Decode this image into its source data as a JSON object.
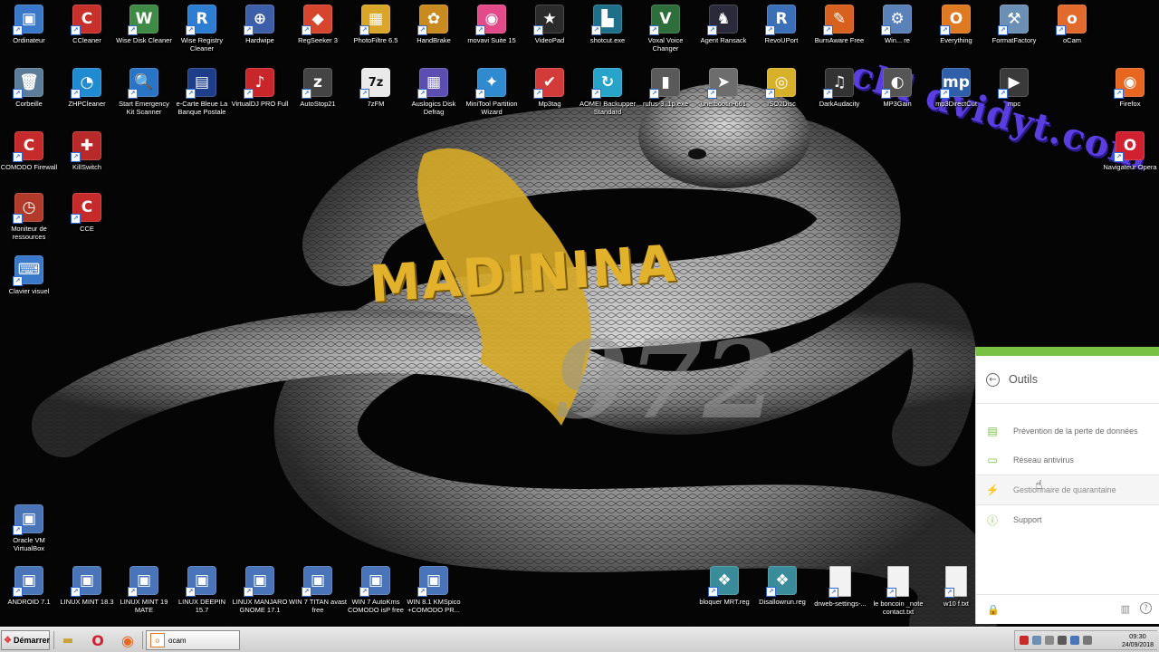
{
  "watermark": "cbl dvidyt.com",
  "wallpaper": {
    "logo_text": "MADININA",
    "number_text": "972"
  },
  "desktop_icons": [
    {
      "id": "ordinateur",
      "label": "Ordinateur",
      "icon": "computer-icon",
      "color": "#3a78c9",
      "glyph": "▣"
    },
    {
      "id": "ccleaner",
      "label": "CCleaner",
      "icon": "ccleaner-icon",
      "color": "#c8312b",
      "glyph": "C"
    },
    {
      "id": "wisedisk",
      "label": "Wise Disk Cleaner",
      "icon": "broom-icon",
      "color": "#3f8a45",
      "glyph": "W"
    },
    {
      "id": "wisereg",
      "label": "Wise Registry Cleaner",
      "icon": "registry-icon",
      "color": "#2d7dd2",
      "glyph": "R"
    },
    {
      "id": "hardwipe",
      "label": "Hardwipe",
      "icon": "crosshair-icon",
      "color": "#3d5fa8",
      "glyph": "⊕"
    },
    {
      "id": "regseeker",
      "label": "RegSeeker 3",
      "icon": "cubes-icon",
      "color": "#d6452d",
      "glyph": "◆"
    },
    {
      "id": "photofiltre",
      "label": "PhotoFiltre 6.5",
      "icon": "palette-icon",
      "color": "#d9a62a",
      "glyph": "▦"
    },
    {
      "id": "handbrake",
      "label": "HandBrake",
      "icon": "pineapple-icon",
      "color": "#c98a1f",
      "glyph": "✿"
    },
    {
      "id": "movavi",
      "label": "movavi Suite 15",
      "icon": "aperture-icon",
      "color": "#e24a8a",
      "glyph": "◉"
    },
    {
      "id": "videopad",
      "label": "VideoPad",
      "icon": "film-star-icon",
      "color": "#2b2b2b",
      "glyph": "★"
    },
    {
      "id": "shotcut",
      "label": "shotcut.exe",
      "icon": "shotcut-icon",
      "color": "#1d6f8a",
      "glyph": "▙"
    },
    {
      "id": "voxal",
      "label": "Voxal Voice Changer",
      "icon": "voxal-icon",
      "color": "#2d6e3a",
      "glyph": "V"
    },
    {
      "id": "agentransack",
      "label": "Agent Ransack",
      "icon": "agent-icon",
      "color": "#2a2a3a",
      "glyph": "♞"
    },
    {
      "id": "revouport",
      "label": "RevoUPort",
      "icon": "revo-icon",
      "color": "#3b6fb8",
      "glyph": "R"
    },
    {
      "id": "burnaware",
      "label": "BurnAware Free",
      "icon": "burnaware-icon",
      "color": "#d8611f",
      "glyph": "✎"
    },
    {
      "id": "winaero",
      "label": "Win... re",
      "icon": "winaero-icon",
      "color": "#5a82b8",
      "glyph": "⚙"
    },
    {
      "id": "everything",
      "label": "Everything",
      "icon": "magnifier-icon",
      "color": "#e07a22",
      "glyph": "O"
    },
    {
      "id": "formatfactory",
      "label": "FormatFactory",
      "icon": "factory-icon",
      "color": "#6b8fb5",
      "glyph": "⚒"
    },
    {
      "id": "ocam",
      "label": "oCam",
      "icon": "ocam-icon",
      "color": "#e26a2c",
      "glyph": "o"
    },
    {
      "id": "corbeille",
      "label": "Corbeille",
      "icon": "recycle-bin-icon",
      "color": "#5b7d99",
      "glyph": "🗑"
    },
    {
      "id": "zhpcleaner",
      "label": "ZHPCleaner",
      "icon": "zhp-icon",
      "color": "#1f8bd0",
      "glyph": "◔"
    },
    {
      "id": "emergencykit",
      "label": "Start Emergency Kit Scanner",
      "icon": "scanner-icon",
      "color": "#2a74c6",
      "glyph": "🔍"
    },
    {
      "id": "ecarte",
      "label": "e-Carte Bleue La Banque Postale",
      "icon": "bank-card-icon",
      "color": "#1e3e8a",
      "glyph": "▤"
    },
    {
      "id": "virtualdj",
      "label": "VirtualDJ PRO Full",
      "icon": "virtualdj-icon",
      "color": "#c8262b",
      "glyph": "♪"
    },
    {
      "id": "autostop",
      "label": "AutoStop21",
      "icon": "sleep-icon",
      "color": "#444",
      "glyph": "z"
    },
    {
      "id": "7zfm",
      "label": "7zFM",
      "icon": "7zip-icon",
      "color": "#eaeaea",
      "glyph": "7z"
    },
    {
      "id": "auslogics",
      "label": "Auslogics Disk Defrag",
      "icon": "defrag-icon",
      "color": "#5a4fb0",
      "glyph": "▦"
    },
    {
      "id": "minitool",
      "label": "MiniTool Partition Wizard",
      "icon": "wizard-icon",
      "color": "#2f8ad0",
      "glyph": "✦"
    },
    {
      "id": "mp3tag",
      "label": "Mp3tag",
      "icon": "check-tag-icon",
      "color": "#d33b3b",
      "glyph": "✔"
    },
    {
      "id": "aomei",
      "label": "AOMEI Backupper Standard",
      "icon": "backup-icon",
      "color": "#28a3c9",
      "glyph": "↻"
    },
    {
      "id": "rufus",
      "label": "rufus-3..1p.exe",
      "icon": "usb-icon",
      "color": "#5a5a5a",
      "glyph": "▮"
    },
    {
      "id": "unetbootin",
      "label": "unetbootin-661",
      "icon": "unetbootin-icon",
      "color": "#6d6d6d",
      "glyph": "➤"
    },
    {
      "id": "iso2disc",
      "label": "ISO2Disc",
      "icon": "disc-icon",
      "color": "#d8b12b",
      "glyph": "◎"
    },
    {
      "id": "darkaudacity",
      "label": "DarkAudacity",
      "icon": "headphones-icon",
      "color": "#333",
      "glyph": "♫"
    },
    {
      "id": "mp3gain",
      "label": "MP3Gain",
      "icon": "gauge-icon",
      "color": "#555",
      "glyph": "◐"
    },
    {
      "id": "mp3directcut",
      "label": "mp3DirectCut",
      "icon": "mp3-icon",
      "color": "#2e5fa8",
      "glyph": "mp"
    },
    {
      "id": "mpc",
      "label": "mpc",
      "icon": "mpc-icon",
      "color": "#3a3a3a",
      "glyph": "▶"
    },
    {
      "id": "firefox",
      "label": "Firefox",
      "icon": "firefox-icon",
      "color": "#e8661f",
      "glyph": "◉"
    },
    {
      "id": "comodofw",
      "label": "COMODO Firewall",
      "icon": "comodo-firewall-icon",
      "color": "#c72a2a",
      "glyph": "C"
    },
    {
      "id": "killswitch",
      "label": "KillSwitch",
      "icon": "killswitch-icon",
      "color": "#b82a2a",
      "glyph": "✚"
    },
    {
      "id": "opera",
      "label": "Navigateur Opera",
      "icon": "opera-icon",
      "color": "#d12030",
      "glyph": "O"
    },
    {
      "id": "moniteur",
      "label": "Moniteur de ressources",
      "icon": "monitor-gauge-icon",
      "color": "#b13a2a",
      "glyph": "◷"
    },
    {
      "id": "cce",
      "label": "CCE",
      "icon": "cce-icon",
      "color": "#c72a2a",
      "glyph": "C"
    },
    {
      "id": "clavier",
      "label": "Clavier visuel",
      "icon": "keyboard-icon",
      "color": "#3a78c9",
      "glyph": "⌨"
    },
    {
      "id": "oraclevm",
      "label": "Oracle VM VirtualBox",
      "icon": "virtualbox-icon",
      "color": "#4a74b8",
      "glyph": "▣"
    },
    {
      "id": "android",
      "label": "ANDROID 7.1",
      "icon": "virtualbox-icon",
      "color": "#4a74b8",
      "glyph": "▣"
    },
    {
      "id": "mint183",
      "label": "LINUX MINT 18.3",
      "icon": "virtualbox-icon",
      "color": "#4a74b8",
      "glyph": "▣"
    },
    {
      "id": "mint19",
      "label": "LINUX MINT 19 MATE",
      "icon": "virtualbox-icon",
      "color": "#4a74b8",
      "glyph": "▣"
    },
    {
      "id": "deepin",
      "label": "LINUX DEEPIN 15.7",
      "icon": "virtualbox-icon",
      "color": "#4a74b8",
      "glyph": "▣"
    },
    {
      "id": "manjaro",
      "label": "LINUX MANJARO GNOME 17.1",
      "icon": "virtualbox-icon",
      "color": "#4a74b8",
      "glyph": "▣"
    },
    {
      "id": "win7titan",
      "label": "WIN 7 TITAN avast free",
      "icon": "virtualbox-icon",
      "color": "#4a74b8",
      "glyph": "▣"
    },
    {
      "id": "win7autokms",
      "label": "WIN 7 AutoKms COMODO isP free",
      "icon": "virtualbox-icon",
      "color": "#4a74b8",
      "glyph": "▣"
    },
    {
      "id": "win81",
      "label": "WIN 8.1 KMSpico +COMODO PR...",
      "icon": "virtualbox-icon",
      "color": "#4a74b8",
      "glyph": "▣"
    },
    {
      "id": "bloquermrt",
      "label": "bloquer MRT.reg",
      "icon": "reg-file-icon",
      "color": "#3a8c9a",
      "glyph": "❖"
    },
    {
      "id": "disallowrun",
      "label": "Disallowrun.reg",
      "icon": "reg-file-icon",
      "color": "#3a8c9a",
      "glyph": "❖"
    },
    {
      "id": "drweb",
      "label": "drweb-settings-...",
      "icon": "text-file-icon",
      "color": "#f2f2f2",
      "glyph": ""
    },
    {
      "id": "leboncoin",
      "label": "le boncoin _note contact.txt",
      "icon": "text-file-icon",
      "color": "#f2f2f2",
      "glyph": ""
    },
    {
      "id": "w10",
      "label": "w10 f.txt",
      "icon": "text-file-icon",
      "color": "#f2f2f2",
      "glyph": ""
    }
  ],
  "panel": {
    "title": "Outils",
    "accent": "#79c142",
    "items": [
      {
        "label": "Prévention de la perte de données",
        "icon": "archive-box-icon",
        "glyph": "▤"
      },
      {
        "label": "Réseau antivirus",
        "icon": "network-monitor-icon",
        "glyph": "▭"
      },
      {
        "label": "Gestionnaire de quarantaine",
        "icon": "lightning-icon",
        "glyph": "⚡"
      },
      {
        "label": "Support",
        "icon": "info-icon",
        "glyph": "ⓘ"
      }
    ]
  },
  "taskbar": {
    "start_label": "Démarrer",
    "active_window": "ocam",
    "clock_time": "09:30",
    "clock_date": "24/09/2018"
  }
}
